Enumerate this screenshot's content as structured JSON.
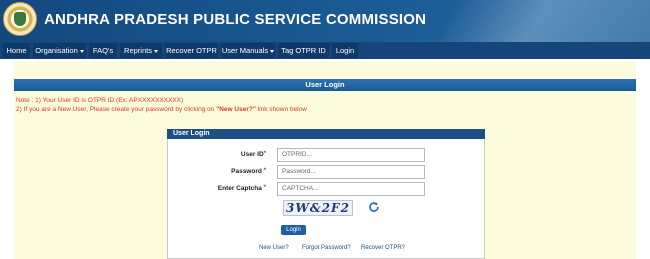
{
  "header": {
    "title": "ANDHRA PRADESH PUBLIC SERVICE COMMISSION",
    "logo": "apsc-emblem"
  },
  "nav": {
    "items": [
      {
        "label": "Home",
        "has_caret": false
      },
      {
        "label": "Organisation",
        "has_caret": true
      },
      {
        "label": "FAQ's",
        "has_caret": false
      },
      {
        "label": "Reprints",
        "has_caret": true
      },
      {
        "label": "Recover OTPR",
        "has_caret": false
      },
      {
        "label": "User Manuals",
        "has_caret": true
      },
      {
        "label": "Tag OTPR ID",
        "has_caret": false
      },
      {
        "label": "Login",
        "has_caret": false
      }
    ]
  },
  "page": {
    "section_title": "User Login",
    "note_line1": "Note : 1) Your User ID is OTPR ID (Ex: APXXXXXXXXXX)",
    "note_line2_a": "2) If you are a New User, Please create your password by clicking on ",
    "note_line2_b": "\"New User?\"",
    "note_line2_c": " link shown below"
  },
  "login": {
    "box_title": "User Login",
    "user_id_label": "User ID",
    "user_id_placeholder": "OTPRID...",
    "password_label": "Password",
    "password_placeholder": "Password...",
    "captcha_label": "Enter Captcha",
    "captcha_placeholder": "CAPTCHA...",
    "captcha_text": "3W&2F2",
    "required_mark": "*",
    "login_button": "Login",
    "links": {
      "new_user": "New User?",
      "forgot_password": "Forgot Password?",
      "recover_otpr": "Recover OTPR?"
    }
  },
  "colors": {
    "header_bg": "#1a5a92",
    "nav_bg": "#16457a",
    "panel_bg": "#fcfcdc",
    "note_red": "#e23a2a",
    "button_blue": "#1e5ea2"
  }
}
